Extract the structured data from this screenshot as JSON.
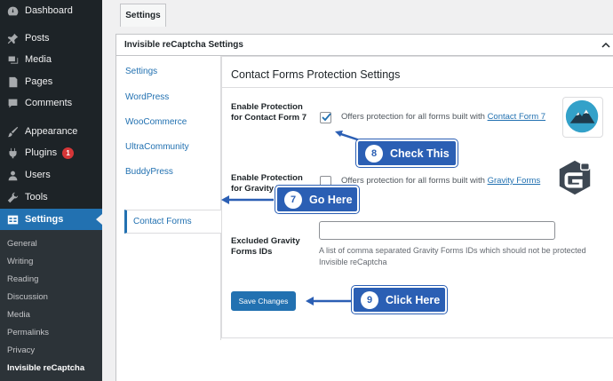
{
  "sidebar": {
    "items": [
      {
        "label": "Dashboard",
        "icon": "dashboard-icon"
      },
      {
        "label": "Posts",
        "icon": "pin-icon"
      },
      {
        "label": "Media",
        "icon": "media-icon"
      },
      {
        "label": "Pages",
        "icon": "page-icon"
      },
      {
        "label": "Comments",
        "icon": "comment-icon"
      },
      {
        "label": "Appearance",
        "icon": "brush-icon"
      },
      {
        "label": "Plugins",
        "icon": "plug-icon",
        "badge": "1"
      },
      {
        "label": "Users",
        "icon": "user-icon"
      },
      {
        "label": "Tools",
        "icon": "wrench-icon"
      },
      {
        "label": "Settings",
        "icon": "settings-icon",
        "active": true
      }
    ],
    "submenu": [
      "General",
      "Writing",
      "Reading",
      "Discussion",
      "Media",
      "Permalinks",
      "Privacy",
      "Invisible reCaptcha"
    ]
  },
  "tabs": {
    "settings": "Settings"
  },
  "panel": {
    "title": "Invisible reCaptcha Settings",
    "nav": [
      "Settings",
      "WordPress",
      "WooCommerce",
      "UltraCommunity",
      "BuddyPress",
      "Contact Forms"
    ]
  },
  "content": {
    "title": "Contact Forms Protection Settings",
    "cf7": {
      "label": "Enable Protection for Contact Form 7",
      "checked": true,
      "desc_prefix": "Offers protection for all forms built with ",
      "link": "Contact Form 7"
    },
    "gravity": {
      "label": "Enable Protection for Gravity Forms",
      "checked": false,
      "desc_prefix": "Offers protection for all forms built with ",
      "link": "Gravity Forms"
    },
    "excluded": {
      "label": "Excluded Gravity Forms IDs",
      "value": "",
      "help_line1": "A list of comma separated Gravity Forms IDs which should not be protected",
      "help_line2": "Invisible reCaptcha"
    },
    "save_label": "Save Changes"
  },
  "callouts": [
    {
      "num": "8",
      "text": "Check This"
    },
    {
      "num": "7",
      "text": "Go Here"
    },
    {
      "num": "9",
      "text": "Click Here"
    }
  ],
  "colors": {
    "accent": "#2271b1",
    "sidebar_bg": "#1d2327",
    "callout": "#2b5fb4"
  }
}
